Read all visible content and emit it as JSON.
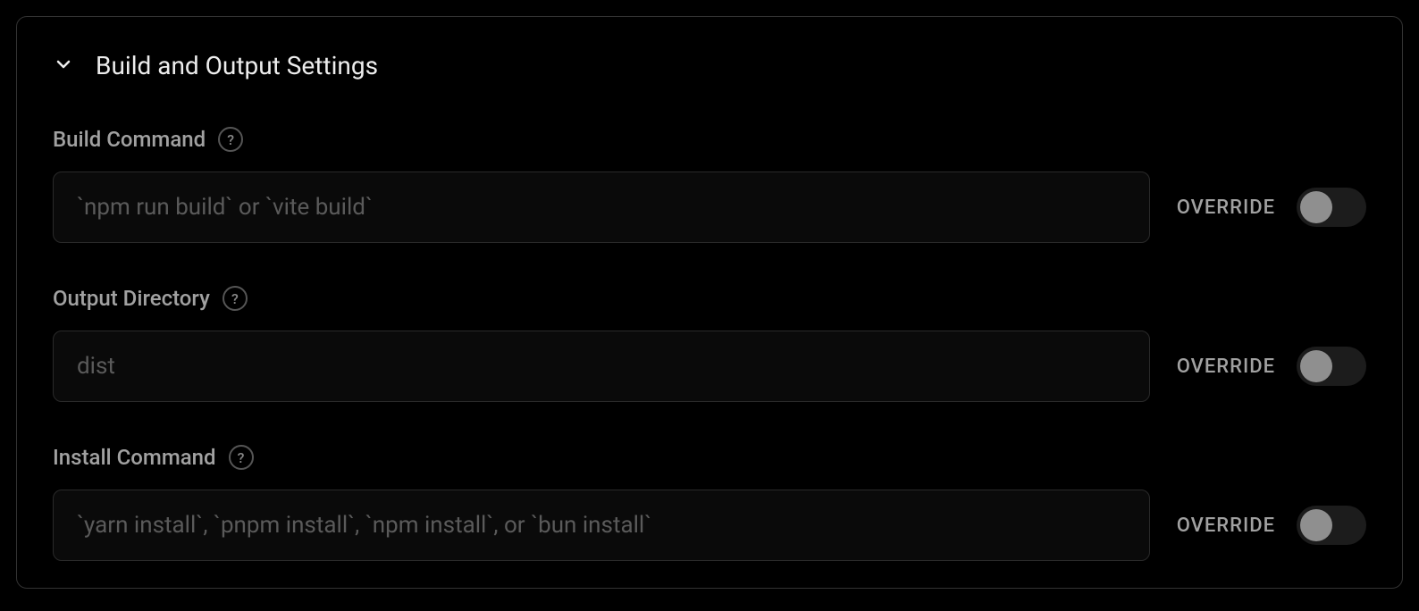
{
  "section": {
    "title": "Build and Output Settings",
    "override_label": "OVERRIDE",
    "fields": {
      "build_command": {
        "label": "Build Command",
        "placeholder": "`npm run build` or `vite build`",
        "value": "",
        "override": false
      },
      "output_directory": {
        "label": "Output Directory",
        "placeholder": "dist",
        "value": "",
        "override": false
      },
      "install_command": {
        "label": "Install Command",
        "placeholder": "`yarn install`, `pnpm install`, `npm install`, or `bun install`",
        "value": "",
        "override": false
      }
    }
  }
}
